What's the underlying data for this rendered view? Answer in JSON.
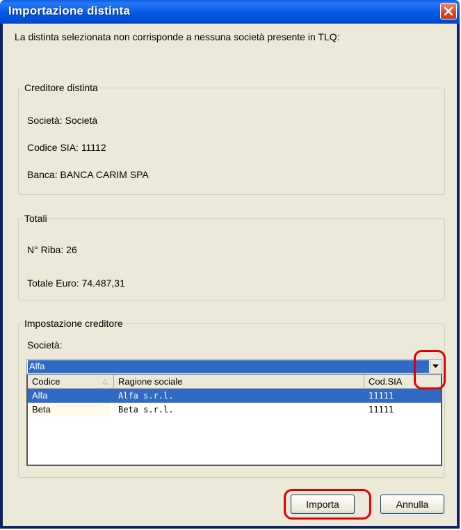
{
  "window": {
    "title": "Importazione distinta"
  },
  "intro_text": "La distinta selezionata non corrisponde a nessuna società presente in TLQ:",
  "creditore": {
    "legend": "Creditore distinta",
    "societa": "Società: Società",
    "codice_sia": "Codice SIA: 11112",
    "banca": "Banca: BANCA  CARIM  SPA"
  },
  "totali": {
    "legend": "Totali",
    "n_riba": "N° Riba: 26",
    "totale_euro": "Totale Euro: 74.487,31"
  },
  "impostazione": {
    "legend": "Impostazione creditore",
    "societa_label": "Società:",
    "selected_value": "Alfa",
    "columns": [
      "Codice",
      "Ragione sociale",
      "Cod.SIA"
    ],
    "sort_indicator": "△",
    "rows": [
      {
        "codice": "Alfa",
        "ragione": "Alfa s.r.l.",
        "cod_sia": "11111",
        "selected": true
      },
      {
        "codice": "Beta",
        "ragione": "Beta s.r.l.",
        "cod_sia": "11111",
        "selected": false
      }
    ]
  },
  "buttons": {
    "importa": "Importa",
    "annulla": "Annulla"
  },
  "colors": {
    "titlebar": "#0058e6",
    "selection": "#316ac5",
    "highlight_marker": "#e00000",
    "dialog_bg": "#ece9d8"
  },
  "icons": {
    "close": "close-icon",
    "dropdown": "chevron-down-icon"
  }
}
